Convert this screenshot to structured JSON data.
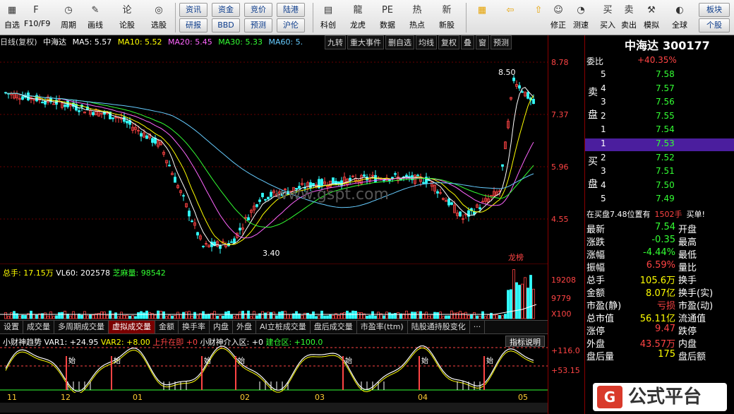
{
  "toolbar": {
    "buttons": [
      {
        "label": "自选",
        "icon": "grid-icon"
      },
      {
        "label": "F10/F9",
        "icon": "f10-icon"
      },
      {
        "label": "周期",
        "icon": "period-icon"
      },
      {
        "label": "画线",
        "icon": "pen-icon"
      },
      {
        "label": "论股",
        "icon": "discuss-icon"
      },
      {
        "label": "选股",
        "icon": "stock-pick-icon"
      }
    ],
    "small": [
      "资讯",
      "资金",
      "竞价",
      "陆港",
      "研报",
      "BBD",
      "预测",
      "沪伦"
    ],
    "buttons2": [
      {
        "label": "科创",
        "icon": "chart-icon"
      },
      {
        "label": "龙虎",
        "icon": "dragon-icon"
      },
      {
        "label": "数据",
        "icon": "pe-icon"
      },
      {
        "label": "热点",
        "icon": "hot-icon"
      },
      {
        "label": "新股",
        "icon": "ipo-icon"
      }
    ],
    "buttons3": [
      {
        "label": "修正",
        "icon": "fix-icon"
      },
      {
        "label": "测速",
        "icon": "clock-icon"
      },
      {
        "label": "买入",
        "icon": "buy-icon"
      },
      {
        "label": "卖出",
        "icon": "sell-icon"
      },
      {
        "label": "模拟",
        "icon": "hammer-icon"
      },
      {
        "label": "全球",
        "icon": "globe-icon"
      }
    ],
    "right_buttons": [
      "板块",
      "个股"
    ]
  },
  "chart": {
    "info": {
      "mode": "日线(复权)",
      "name": "中海达",
      "ma5": "MA5: 5.57",
      "ma10": "MA10: 5.52",
      "ma20": "MA20: 5.45",
      "ma30": "MA30: 5.33",
      "ma60": "MA60: 5."
    },
    "chart_buttons": [
      "九转",
      "重大事件",
      "删自选",
      "均线",
      "复权",
      "叠",
      "窗",
      "预测"
    ],
    "price_axis": [
      "8.78",
      "7.37",
      "5.96",
      "4.55"
    ],
    "high_label": "8.50",
    "low_label": "3.40",
    "dragon_label": "龙榜",
    "vol_info": {
      "total": "总手: 17.15万",
      "vl60": "VL60: 202578",
      "zhima": "芝麻量: 98542"
    },
    "vol_axis": [
      "19208",
      "9779",
      "X100"
    ],
    "tabs": [
      "设置",
      "成交量",
      "多周期成交量",
      "虚拟成交量",
      "金额",
      "换手率",
      "内盘",
      "外盘",
      "AI立桩成交量",
      "盘后成交量",
      "市盈率(ttm)",
      "陆股通持股变化",
      "···"
    ],
    "active_tab": "虚拟成交量",
    "ind_info": {
      "name": "小财神趋势",
      "var1": "VAR1: +24.95",
      "var2": "VAR2: +8.00",
      "rise": "上升在即 +0",
      "inner": "小财神介入区: +0",
      "build": "建仓区: +100.0"
    },
    "ind_btn": "指标说明",
    "ind_axis": [
      "+116.0",
      "+53.15"
    ],
    "ind_label": "始",
    "dates": [
      "11",
      "12",
      "01",
      "02",
      "03",
      "04",
      "05"
    ],
    "watermark_text": "www.gspt.com"
  },
  "quote": {
    "name": "中海达",
    "code": "300177",
    "weibi_label": "委比",
    "weibi": "+40.35%",
    "sell_label": [
      "卖",
      "盘"
    ],
    "buy_label": [
      "买",
      "盘"
    ],
    "sells": [
      {
        "n": "5",
        "p": "7.58"
      },
      {
        "n": "4",
        "p": "7.57"
      },
      {
        "n": "3",
        "p": "7.56"
      },
      {
        "n": "2",
        "p": "7.55"
      },
      {
        "n": "1",
        "p": "7.54"
      }
    ],
    "buys": [
      {
        "n": "1",
        "p": "7.53"
      },
      {
        "n": "2",
        "p": "7.52"
      },
      {
        "n": "3",
        "p": "7.51"
      },
      {
        "n": "4",
        "p": "7.50"
      },
      {
        "n": "5",
        "p": "7.49"
      }
    ],
    "notice": {
      "text": "在买盘7.48位置有",
      "vol": "1502手",
      "tail": "买单!"
    },
    "stats": [
      {
        "l": "最新",
        "v": "7.54",
        "r": "开盘"
      },
      {
        "l": "涨跌",
        "v": "-0.35",
        "r": "最高"
      },
      {
        "l": "涨幅",
        "v": "-4.44%",
        "r": "最低"
      },
      {
        "l": "振幅",
        "v": "6.59%",
        "r": "量比"
      },
      {
        "l": "总手",
        "v": "105.6万",
        "r": "换手"
      },
      {
        "l": "金额",
        "v": "8.07亿",
        "r": "换手(实)"
      },
      {
        "l": "市盈(静)",
        "v": "亏损",
        "r": "市盈(动)"
      },
      {
        "l": "总市值",
        "v": "56.11亿",
        "r": "流通值"
      },
      {
        "l": "涨停",
        "v": "9.47",
        "r": "跌停"
      },
      {
        "l": "外盘",
        "v": "43.57万",
        "r": "内盘"
      },
      {
        "l": "盘后量",
        "v": "175",
        "r": "盘后额"
      }
    ]
  },
  "brand": {
    "logo": "G",
    "name": "公式平台"
  },
  "colors": {
    "up": "#ff4444",
    "down": "#33ffff",
    "ma5": "#ffffff",
    "ma10": "#ffff00",
    "ma20": "#ff66ff",
    "ma30": "#33ff33",
    "ma60": "#66ccff"
  }
}
